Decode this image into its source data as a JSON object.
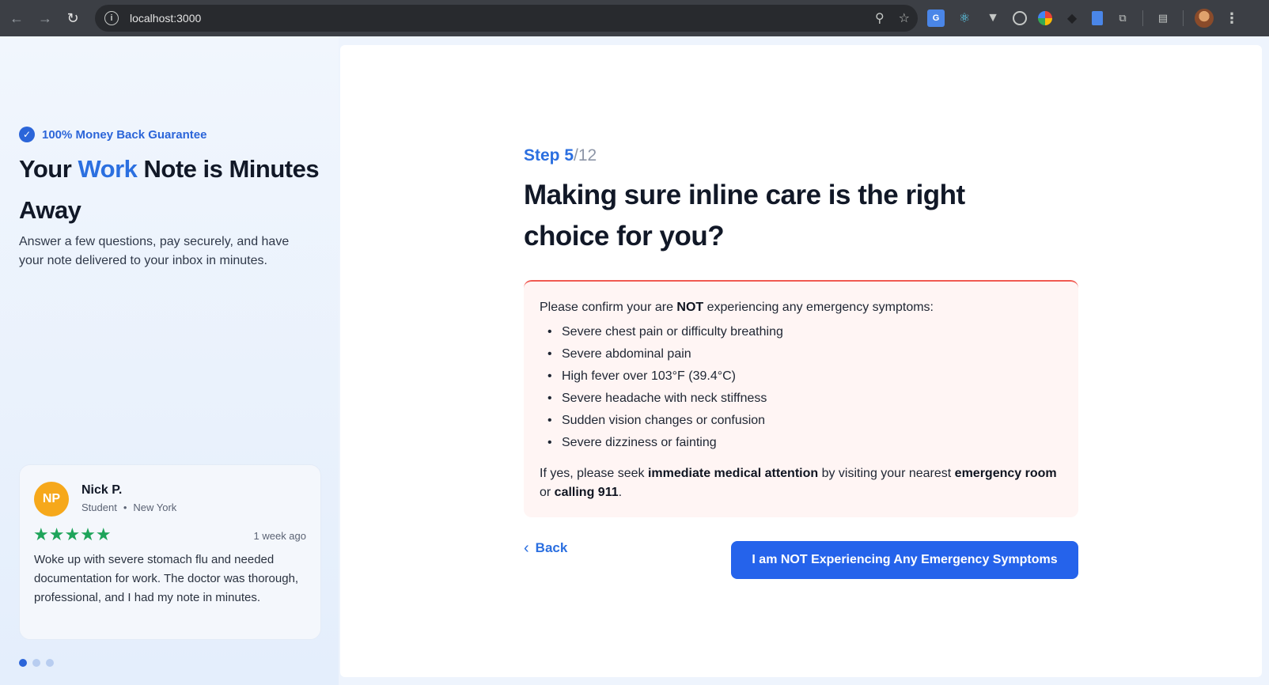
{
  "browser": {
    "url": "localhost:3000",
    "back_icon": "arrow-left-icon",
    "forward_icon": "arrow-right-icon",
    "reload_icon": "reload-icon",
    "zoom_icon": "zoom-icon",
    "bookmark_icon": "star-icon",
    "extensions": [
      "translate-icon",
      "react-devtools-icon",
      "vue-devtools-icon",
      "target-icon",
      "colorful-extension-icon",
      "dark-extension-icon",
      "document-extension-icon",
      "puzzle-icon"
    ]
  },
  "left": {
    "guarantee": "100% Money Back Guarantee",
    "title_part1": "Your ",
    "title_accent": "Work",
    "title_part2": " Note is Minutes Away",
    "subtitle": "Answer a few questions, pay securely, and have your note delivered to your inbox in minutes.",
    "review": {
      "initials": "NP",
      "name": "Nick P.",
      "role": "Student",
      "separator": "•",
      "location": "New York",
      "stars": "★★★★★",
      "rating": 5,
      "time": "1 week ago",
      "text": "Woke up with severe stomach flu and needed documentation for work. The doctor was thorough, professional, and I had my note in minutes."
    },
    "carousel": {
      "count": 3,
      "active": 0
    }
  },
  "main": {
    "step_current": "Step 5",
    "step_total": "/12",
    "question": "Making sure inline care is the right choice for you?",
    "warning": {
      "intro_before": "Please confirm your are ",
      "intro_bold": "NOT",
      "intro_after": " experiencing any emergency symptoms:",
      "symptoms": [
        "Severe chest pain or difficulty breathing",
        "Severe abdominal pain",
        "High fever over 103°F (39.4°C)",
        "Severe headache with neck stiffness",
        "Sudden vision changes or confusion",
        "Severe dizziness or fainting"
      ],
      "outro_1": "If yes, please seek ",
      "outro_bold_1": "immediate medical attention",
      "outro_2": " by visiting your nearest ",
      "outro_bold_2": "emergency room",
      "outro_3": " or ",
      "outro_bold_3": "calling 911",
      "outro_4": "."
    },
    "back_label": "Back",
    "confirm_label": "I am NOT Experiencing Any Emergency Symptoms"
  },
  "colors": {
    "accent": "#2b6fe0",
    "button": "#2563eb",
    "warning_border": "#f05a52",
    "warning_bg": "#fff5f4",
    "stars": "#1ea45a",
    "avatar": "#f6a81b"
  }
}
